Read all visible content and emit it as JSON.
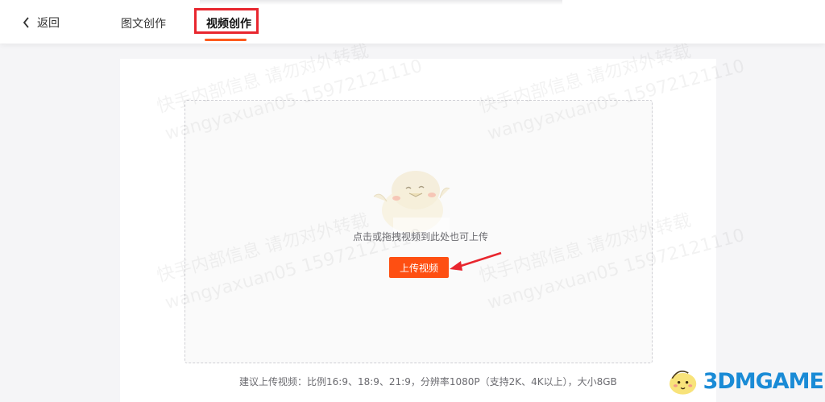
{
  "nav": {
    "back_label": "返回",
    "tabs": [
      {
        "label": "图文创作",
        "active": false
      },
      {
        "label": "视频创作",
        "active": true
      }
    ],
    "accent_color": "#fe5a1d",
    "highlight_color": "#e8262e"
  },
  "upload": {
    "hint": "点击或拖拽视频到此处也可上传",
    "button_label": "上传视频",
    "button_color": "#fe4f12",
    "suggestion": "建议上传视频：比例16:9、18:9、21:9，分辨率1080P（支持2K、4K以上），大小8GB"
  },
  "watermark": {
    "lines": [
      "快手内部信息 请勿对外转载",
      "wangyaxuan05 15972121110"
    ]
  },
  "logo": {
    "text": "3DMGAME"
  },
  "icons": [
    "back-chevron-icon",
    "mascot-illustration",
    "annotation-arrow-icon",
    "3dm-logo-icon"
  ]
}
